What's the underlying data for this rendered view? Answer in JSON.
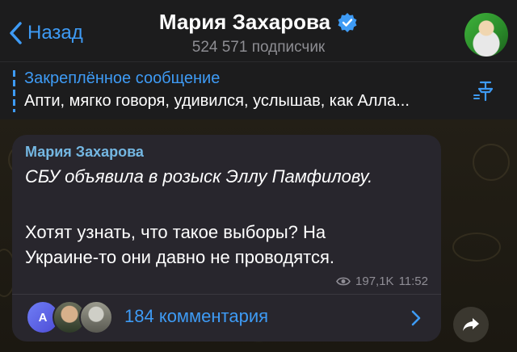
{
  "header": {
    "back_label": "Назад",
    "channel_name": "Мария Захарова",
    "subscribers": "524 571 подписчик",
    "verified": true
  },
  "pinned": {
    "title": "Закреплённое сообщение",
    "text": "Апти, мягко говоря, удивился, услышав, как Алла..."
  },
  "message": {
    "author": "Мария Захарова",
    "headline": "СБУ объявила в розыск Эллу Памфилову.",
    "body_line1": "Хотят узнать, что такое выборы?  На",
    "body_line2": "Украине-то они давно не проводятся.",
    "views": "197,1K",
    "time": "11:52",
    "comments_label": "184 комментария",
    "commenter_initial": "А"
  },
  "colors": {
    "accent": "#3e9bf5",
    "author_name": "#74b7e2",
    "bubble": "#28262d",
    "header_bg": "#1c1c1d"
  },
  "icons": [
    "chevron-left-icon",
    "verified-badge-icon",
    "pin-icon",
    "eye-icon",
    "chevron-right-icon",
    "share-arrow-icon"
  ]
}
